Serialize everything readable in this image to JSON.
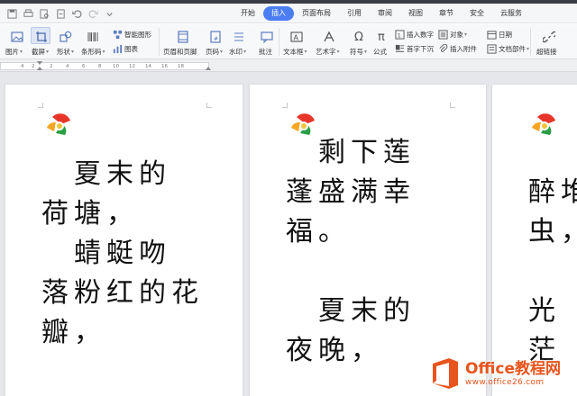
{
  "menu": {
    "tabs": [
      "开始",
      "插入",
      "页面布局",
      "引用",
      "审阅",
      "视图",
      "章节",
      "安全",
      "云服务"
    ],
    "active_tab": "插入"
  },
  "ribbon": {
    "picture": "图片",
    "screenshot": "截屏",
    "shapes": "形状",
    "barcode": "条形码",
    "smart_art": "智能图形",
    "chart": "图表",
    "header_footer": "页眉和页脚",
    "page_number": "页码",
    "watermark": "水印",
    "comment": "批注",
    "textbox": "文本框",
    "wordart": "艺术字",
    "symbol": "符号",
    "formula": "公式",
    "insert_number": "插入数字",
    "object": "对象",
    "drop_cap": "首字下沉",
    "insert_attachment": "插入附件",
    "date": "日期",
    "doc_parts": "文档部件",
    "hyperlink": "超链接"
  },
  "ruler": {
    "labels": [
      "4",
      "2",
      "2",
      "4",
      "6",
      "8",
      "10",
      "12",
      "14",
      "16",
      "18"
    ]
  },
  "pages": [
    {
      "lines": [
        "　夏末的",
        "荷塘，",
        "　蜻蜓吻",
        "落粉红的花",
        "瓣，"
      ]
    },
    {
      "lines": [
        "　剩下莲",
        "蓬盛满幸",
        "福。",
        "",
        "　夏末的",
        "夜晚，"
      ]
    },
    {
      "lines": [
        "醉堆",
        "虫，",
        "",
        "光",
        "茫"
      ]
    }
  ],
  "watermark": {
    "title": "Office教程网",
    "url": "www.office26.com"
  },
  "colors": {
    "active_tab": "#4c7ef3",
    "watermark": "#e8541d",
    "workspace": "#e6e7ea"
  }
}
